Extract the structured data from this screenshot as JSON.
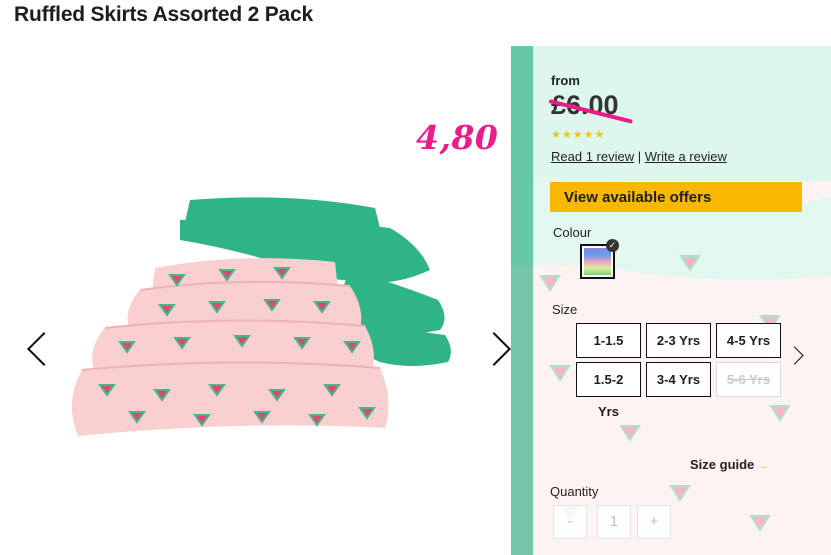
{
  "product": {
    "title": "Ruffled Skirts Assorted 2 Pack"
  },
  "annotation": {
    "handwritten_price": "4,80",
    "color": "#ea1c8a"
  },
  "pricing": {
    "from_label": "from",
    "old_price": "£6.00",
    "rating_stars": 5,
    "stars_text": "★★★★★",
    "read_review": "Read 1 review",
    "separator": "|",
    "write_review": "Write a review"
  },
  "offers_button": {
    "label": "View available offers",
    "color": "#f9b800"
  },
  "colour": {
    "label": "Colour",
    "selected": true
  },
  "size": {
    "label": "Size",
    "options": [
      {
        "label": "1-1.5 Yrs",
        "available": true
      },
      {
        "label": "2-3 Yrs",
        "available": true
      },
      {
        "label": "4-5 Yrs",
        "available": true
      },
      {
        "label": "1.5-2 Yrs",
        "available": true
      },
      {
        "label": "3-4 Yrs",
        "available": true
      },
      {
        "label": "5-6 Yrs",
        "available": false
      }
    ]
  },
  "size_guide": {
    "label": "Size guide",
    "arrow": "→"
  },
  "quantity": {
    "label": "Quantity",
    "minus": "-",
    "value": "1",
    "plus": "+"
  },
  "icons": {
    "prev": "chevron-left-icon",
    "next": "chevron-right-icon",
    "size_next": "chevron-right-icon",
    "tick": "check-icon"
  },
  "colors": {
    "green_skirt": "#2fb487",
    "pink_skirt": "#f9cfd0",
    "watermelon": "#e0457a"
  }
}
